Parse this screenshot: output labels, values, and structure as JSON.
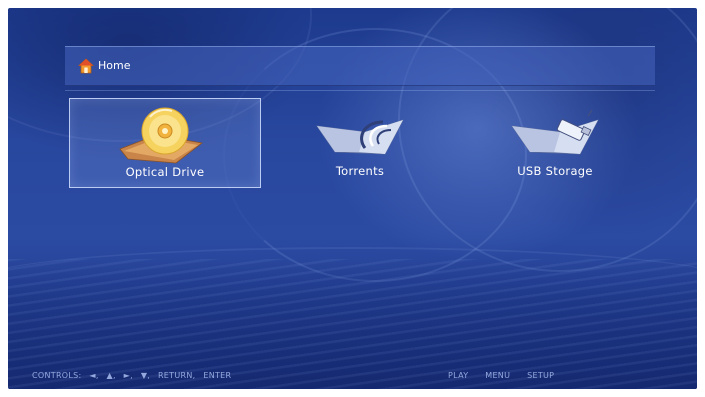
{
  "header": {
    "title": "Home",
    "icon": "home-icon"
  },
  "tiles": [
    {
      "label": "Optical Drive",
      "icon": "optical-disc-icon",
      "selected": true
    },
    {
      "label": "Torrents",
      "icon": "torrent-folder-icon",
      "selected": false
    },
    {
      "label": "USB Storage",
      "icon": "usb-folder-icon",
      "selected": false
    }
  ],
  "footer": {
    "controls_label": "CONTROLS:",
    "controls_keys": [
      "◄,",
      "▲,",
      "►,",
      "▼,",
      "RETURN,",
      "ENTER"
    ],
    "actions": [
      "PLAY",
      "MENU",
      "SETUP"
    ]
  },
  "colors": {
    "background": "#2b4aa2",
    "header_bar": "#4664be",
    "text": "#ffffff",
    "footer_text": "#aabef0",
    "home_icon": "#f29a2e"
  }
}
